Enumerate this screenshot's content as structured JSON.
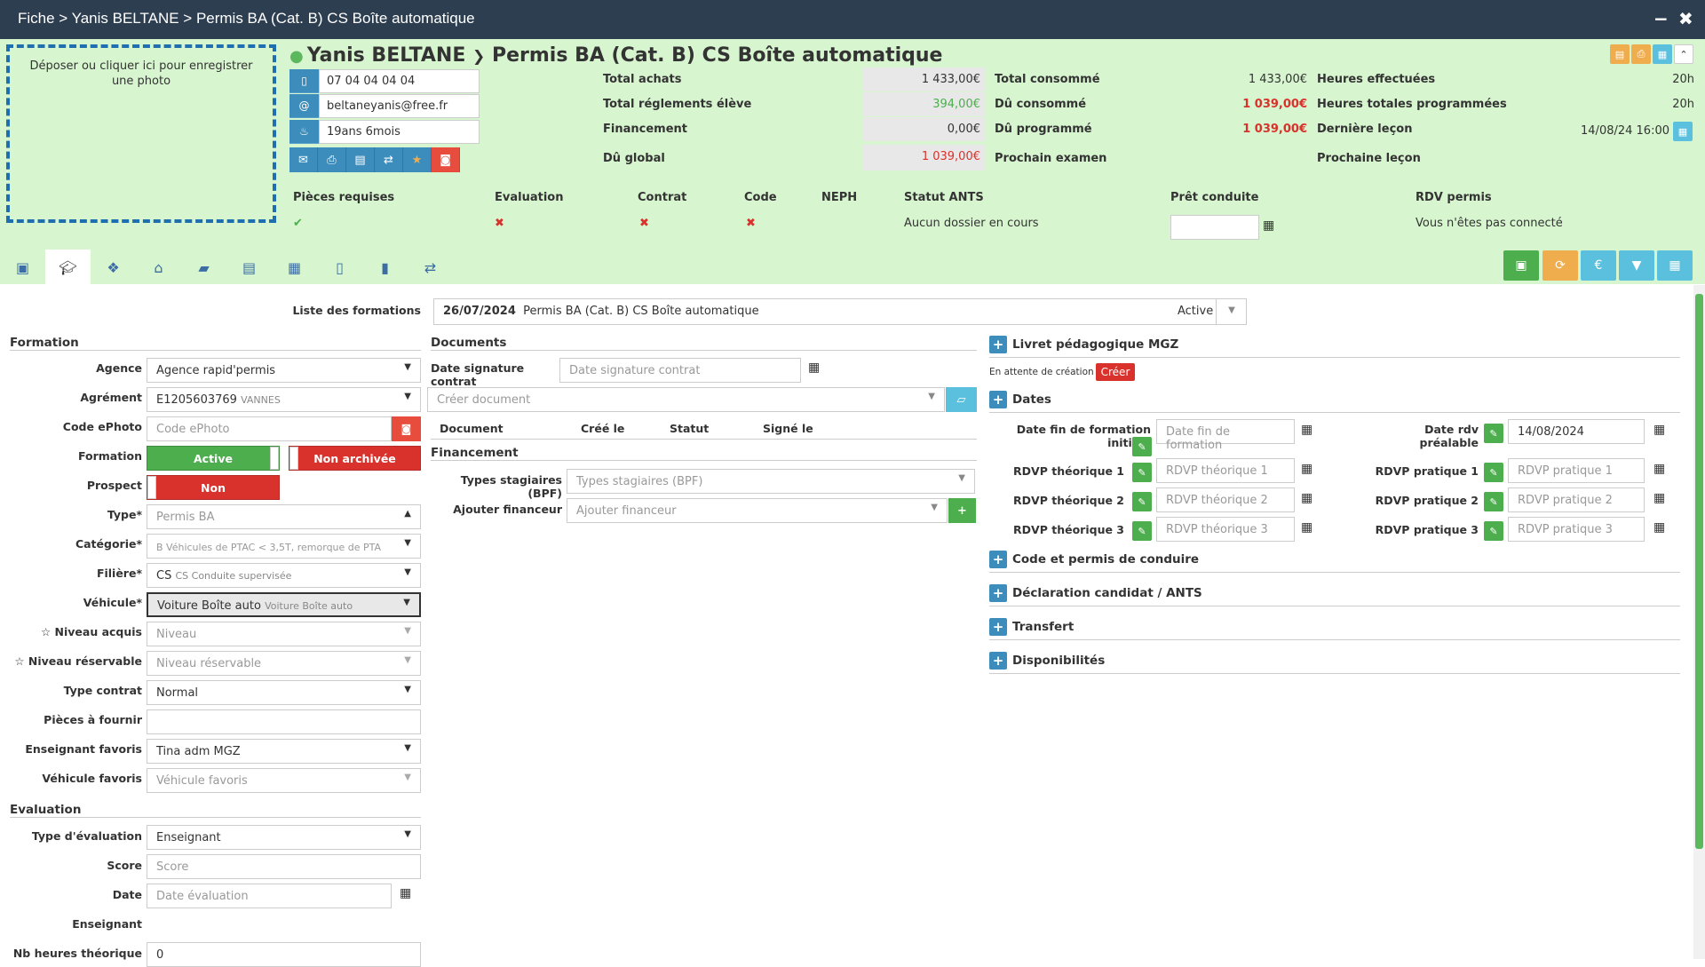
{
  "window": {
    "title": "Fiche > Yanis BELTANE > Permis BA (Cat. B) CS Boîte automatique",
    "minimize": "−",
    "close": "✖"
  },
  "photo": {
    "text": "Déposer ou cliquer ici pour enregistrer une photo"
  },
  "student": {
    "name": "Yanis BELTANE",
    "sep": "❯",
    "formation": "Permis BA (Cat. B) CS Boîte automatique",
    "phone": "07 04 04 04 04",
    "email": "beltaneyanis@free.fr",
    "age": "19ans 6mois"
  },
  "finance": {
    "total_achats_label": "Total achats",
    "total_achats": "1 433,00€",
    "reglements_label": "Total réglements élève",
    "reglements": "394,00€",
    "financement_label": "Financement",
    "financement": "0,00€",
    "du_global_label": "Dû global",
    "du_global": "1 039,00€",
    "total_consomme_label": "Total consommé",
    "total_consomme": "1 433,00€",
    "du_consomme_label": "Dû consommé",
    "du_consomme": "1 039,00€",
    "du_programme_label": "Dû programmé",
    "du_programme": "1 039,00€",
    "prochain_examen_label": "Prochain examen",
    "heures_effectuees_label": "Heures effectuées",
    "heures_effectuees": "20h",
    "heures_prog_label": "Heures totales programmées",
    "heures_prog": "20h",
    "derniere_lecon_label": "Dernière leçon",
    "derniere_lecon": "14/08/24 16:00",
    "prochaine_lecon_label": "Prochaine leçon"
  },
  "requirements": {
    "pieces_label": "Pièces requises",
    "pieces_value": "✔",
    "evaluation_label": "Evaluation",
    "evaluation_value": "✖",
    "contrat_label": "Contrat",
    "contrat_value": "✖",
    "code_label": "Code",
    "code_value": "✖",
    "neph_label": "NEPH",
    "statut_ants_label": "Statut ANTS",
    "statut_ants_value": "Aucun dossier en cours",
    "pret_label": "Prêt conduite",
    "rdv_label": "RDV permis",
    "rdv_value": "Vous n'êtes pas connecté"
  },
  "formations_list": {
    "label": "Liste des formations",
    "date": "26/07/2024",
    "name": "Permis BA (Cat. B) CS Boîte automatique",
    "status": "Active"
  },
  "formation": {
    "section": "Formation",
    "agence_label": "Agence",
    "agence": "Agence rapid'permis",
    "agrement_label": "Agrément",
    "agrement": "E1205603769",
    "agrement_city": "VANNES",
    "ephoto_label": "Code ePhoto",
    "ephoto_placeholder": "Code ePhoto",
    "formation_label": "Formation",
    "formation_active": "Active",
    "formation_archive": "Non archivée",
    "prospect_label": "Prospect",
    "prospect_value": "Non",
    "type_label": "Type*",
    "type_value": "Permis BA",
    "categorie_label": "Catégorie*",
    "categorie_code": "B",
    "categorie_value": "B Véhicules de PTAC < 3,5T, remorque de PTA",
    "filiere_label": "Filière*",
    "filiere_code": "CS",
    "filiere_value": "CS Conduite supervisée",
    "vehicule_label": "Véhicule*",
    "vehicule_value": "Voiture Boîte auto",
    "vehicule_sub": "Voiture Boîte auto",
    "niveau_acquis_label": "☆ Niveau acquis",
    "niveau_acquis": "Niveau",
    "niveau_res_label": "☆ Niveau réservable",
    "niveau_res": "Niveau réservable",
    "type_contrat_label": "Type contrat",
    "type_contrat": "Normal",
    "pieces_label": "Pièces à fournir",
    "enseignant_label": "Enseignant favoris",
    "enseignant": "Tina adm MGZ",
    "vehicule_fav_label": "Véhicule favoris",
    "vehicule_fav": "Véhicule favoris"
  },
  "evaluation": {
    "section": "Evaluation",
    "type_label": "Type d'évaluation",
    "type_value": "Enseignant",
    "score_label": "Score",
    "score_placeholder": "Score",
    "date_label": "Date",
    "date_placeholder": "Date évaluation",
    "enseignant_label": "Enseignant",
    "nb_heures_label": "Nb heures théorique",
    "nb_heures": "0"
  },
  "documents": {
    "section": "Documents",
    "date_sig_label": "Date signature contrat",
    "date_sig_placeholder": "Date signature contrat",
    "creer_placeholder": "Créer document",
    "col_document": "Document",
    "col_cree": "Créé le",
    "col_statut": "Statut",
    "col_signe": "Signé le",
    "financement_section": "Financement",
    "types_label": "Types stagiaires (BPF)",
    "types_placeholder": "Types stagiaires (BPF)",
    "financeur_label": "Ajouter financeur",
    "financeur_placeholder": "Ajouter financeur"
  },
  "right": {
    "livret": "Livret pédagogique MGZ",
    "attente": "En attente de création",
    "creer": "Créer",
    "dates": "Dates",
    "date_fin_label": "Date fin de formation initiale",
    "date_fin_placeholder": "Date fin de formation",
    "rdv_prealable_label": "Date rdv préalable",
    "rdv_prealable": "14/08/2024",
    "rdvp_t1_label": "RDVP théorique 1",
    "rdvp_t1": "RDVP théorique 1",
    "rdvp_t2_label": "RDVP théorique 2",
    "rdvp_t2": "RDVP théorique 2",
    "rdvp_t3_label": "RDVP théorique 3",
    "rdvp_t3": "RDVP théorique 3",
    "rdvp_p1_label": "RDVP pratique 1",
    "rdvp_p1": "RDVP pratique 1",
    "rdvp_p2_label": "RDVP pratique 2",
    "rdvp_p2": "RDVP pratique 2",
    "rdvp_p3_label": "RDVP pratique 3",
    "rdvp_p3": "RDVP pratique 3",
    "code_permis": "Code et permis de conduire",
    "declaration": "Déclaration candidat / ANTS",
    "transfert": "Transfert",
    "disponibilites": "Disponibilités"
  },
  "colors": {
    "header": "#2c3e50",
    "panel": "#d7f5cf",
    "accent": "#3c8dbc",
    "success": "#4cae4c",
    "danger": "#d9312b",
    "warning": "#f0ad4e"
  }
}
